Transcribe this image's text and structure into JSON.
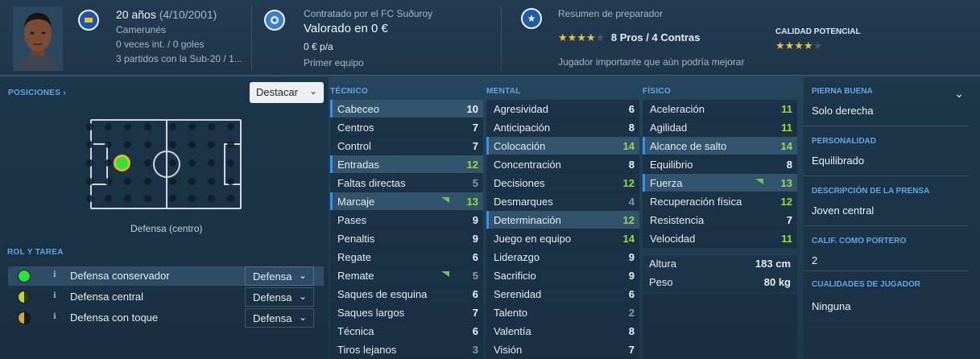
{
  "header": {
    "age": "20 años",
    "birth": "(4/10/2001)",
    "nationality": "Camerunés",
    "caps": "0 veces int. / 0 goles",
    "u20": "3 partidos con la Sub-20 / 1...",
    "contract": "Contratado por el FC Suðuroy",
    "value": "Valorado en 0 €",
    "wage": "0 € p/a",
    "squad": "Primer equipo",
    "coach_title": "Resumen de preparador",
    "pros_cons": "8 Pros / 4 Contras",
    "coach_note": "Jugador importante que aún podría mejorar",
    "coach_stars": 4,
    "potential_label": "CALIDAD POTENCIAL",
    "potential_stars": 4,
    "icons": [
      "nationality-badge-icon",
      "club-crest-icon",
      "star-icon"
    ]
  },
  "left": {
    "positions_label": "POSICIONES ›",
    "highlight_select": "Destacar",
    "position_name": "Defensa (centro)",
    "role_title": "ROL Y TAREA",
    "roles": [
      {
        "name": "Defensa conservador",
        "duty": "Defensa",
        "color": "#2fe23a"
      },
      {
        "name": "Defensa central",
        "duty": "Defensa",
        "color": "#c5d42a"
      },
      {
        "name": "Defensa con toque",
        "duty": "Defensa",
        "color": "#d9a820"
      }
    ]
  },
  "technical": {
    "title": "TÉCNICO",
    "items": [
      {
        "name": "Cabeceo",
        "value": "10"
      },
      {
        "name": "Centros",
        "value": "7"
      },
      {
        "name": "Control",
        "value": "7"
      },
      {
        "name": "Entradas",
        "value": "12"
      },
      {
        "name": "Faltas directas",
        "value": "5"
      },
      {
        "name": "Marcaje",
        "value": "13"
      },
      {
        "name": "Pases",
        "value": "9"
      },
      {
        "name": "Penaltis",
        "value": "9"
      },
      {
        "name": "Regate",
        "value": "6"
      },
      {
        "name": "Remate",
        "value": "5"
      },
      {
        "name": "Saques de esquina",
        "value": "6"
      },
      {
        "name": "Saques largos",
        "value": "7"
      },
      {
        "name": "Técnica",
        "value": "6"
      },
      {
        "name": "Tiros lejanos",
        "value": "3"
      }
    ]
  },
  "mental": {
    "title": "MENTAL",
    "items": [
      {
        "name": "Agresividad",
        "value": "6"
      },
      {
        "name": "Anticipación",
        "value": "8"
      },
      {
        "name": "Colocación",
        "value": "14"
      },
      {
        "name": "Concentración",
        "value": "8"
      },
      {
        "name": "Decisiones",
        "value": "12"
      },
      {
        "name": "Desmarques",
        "value": "4"
      },
      {
        "name": "Determinación",
        "value": "12"
      },
      {
        "name": "Juego en equipo",
        "value": "14"
      },
      {
        "name": "Liderazgo",
        "value": "9"
      },
      {
        "name": "Sacrificio",
        "value": "9"
      },
      {
        "name": "Serenidad",
        "value": "6"
      },
      {
        "name": "Talento",
        "value": "2"
      },
      {
        "name": "Valentía",
        "value": "8"
      },
      {
        "name": "Visión",
        "value": "7"
      }
    ]
  },
  "physical": {
    "title": "FÍSICO",
    "items": [
      {
        "name": "Aceleración",
        "value": "11"
      },
      {
        "name": "Agilidad",
        "value": "11"
      },
      {
        "name": "Alcance de salto",
        "value": "14"
      },
      {
        "name": "Equilibrio",
        "value": "8"
      },
      {
        "name": "Fuerza",
        "value": "13"
      },
      {
        "name": "Recuperación física",
        "value": "12"
      },
      {
        "name": "Resistencia",
        "value": "7"
      },
      {
        "name": "Velocidad",
        "value": "11"
      }
    ],
    "height_label": "Altura",
    "height": "183 cm",
    "weight_label": "Peso",
    "weight": "80 kg"
  },
  "right": {
    "foot_label": "PIERNA BUENA",
    "foot": "Solo derecha",
    "personality_label": "PERSONALIDAD",
    "personality": "Equilibrado",
    "press_label": "DESCRIPCIÓN DE LA PRENSA",
    "press": "Joven central",
    "gk_label": "CALIF. COMO PORTERO",
    "gk": "2",
    "qualities_label": "CUALIDADES DE JUGADOR",
    "qualities": "Ninguna"
  }
}
